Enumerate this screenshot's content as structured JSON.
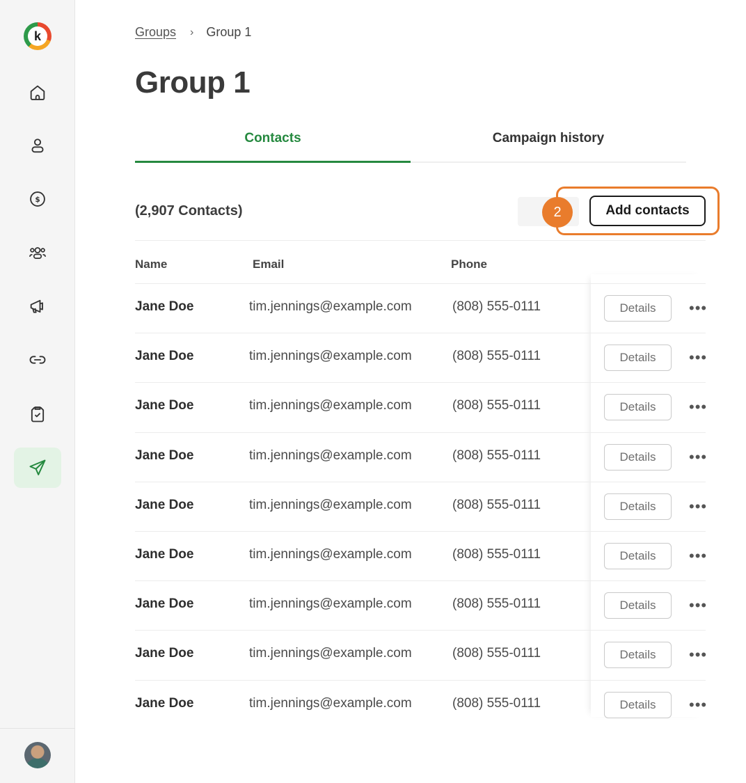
{
  "sidebar": {
    "logo_letter": "k",
    "items": [
      {
        "icon": "home-icon"
      },
      {
        "icon": "user-icon"
      },
      {
        "icon": "dollar-icon"
      },
      {
        "icon": "users-group-icon"
      },
      {
        "icon": "megaphone-icon"
      },
      {
        "icon": "link-icon"
      },
      {
        "icon": "clipboard-check-icon"
      },
      {
        "icon": "send-icon",
        "active": true
      }
    ],
    "active_color": "#25893f"
  },
  "breadcrumb": {
    "parent": "Groups",
    "current": "Group 1",
    "separator": "›"
  },
  "page": {
    "title": "Group 1"
  },
  "tabs": [
    {
      "label": "Contacts",
      "active": true
    },
    {
      "label": "Campaign history",
      "active": false
    }
  ],
  "contacts": {
    "count_label": "(2,907 Contacts)",
    "add_button": "Add contacts",
    "step_badge": "2",
    "columns": {
      "name": "Name",
      "email": "Email",
      "phone": "Phone"
    },
    "details_label": "Details",
    "more_label": "•••",
    "rows": [
      {
        "name": "Jane Doe",
        "email": "tim.jennings@example.com",
        "phone": "(808) 555-0111"
      },
      {
        "name": "Jane Doe",
        "email": "tim.jennings@example.com",
        "phone": "(808) 555-0111"
      },
      {
        "name": "Jane Doe",
        "email": "tim.jennings@example.com",
        "phone": "(808) 555-0111"
      },
      {
        "name": "Jane Doe",
        "email": "tim.jennings@example.com",
        "phone": "(808) 555-0111"
      },
      {
        "name": "Jane Doe",
        "email": "tim.jennings@example.com",
        "phone": "(808) 555-0111"
      },
      {
        "name": "Jane Doe",
        "email": "tim.jennings@example.com",
        "phone": "(808) 555-0111"
      },
      {
        "name": "Jane Doe",
        "email": "tim.jennings@example.com",
        "phone": "(808) 555-0111"
      },
      {
        "name": "Jane Doe",
        "email": "tim.jennings@example.com",
        "phone": "(808) 555-0111"
      },
      {
        "name": "Jane Doe",
        "email": "tim.jennings@example.com",
        "phone": "(808) 555-0111"
      }
    ]
  },
  "colors": {
    "accent": "#25893f",
    "highlight": "#e97c2c"
  }
}
